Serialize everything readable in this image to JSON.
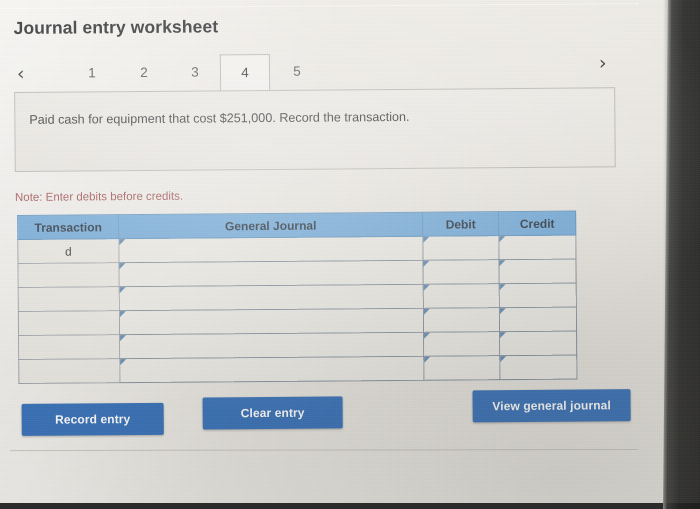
{
  "header": {
    "title": "Journal entry worksheet"
  },
  "pager": {
    "prev_icon": "chevron-left-icon",
    "next_icon": "chevron-right-icon",
    "prev_glyph": "‹",
    "next_glyph": "›",
    "tabs": [
      {
        "label": "1",
        "active": false
      },
      {
        "label": "2",
        "active": false
      },
      {
        "label": "3",
        "active": false
      },
      {
        "label": "4",
        "active": true
      },
      {
        "label": "5",
        "active": false
      }
    ],
    "active_tab": "4"
  },
  "question": {
    "text": "Paid cash for equipment that cost $251,000. Record the transaction."
  },
  "note": {
    "text": "Note: Enter debits before credits."
  },
  "table": {
    "columns": [
      "Transaction",
      "General Journal",
      "Debit",
      "Credit"
    ],
    "rows": [
      {
        "transaction": "d",
        "general_journal": "",
        "debit": "",
        "credit": ""
      },
      {
        "transaction": "",
        "general_journal": "",
        "debit": "",
        "credit": ""
      },
      {
        "transaction": "",
        "general_journal": "",
        "debit": "",
        "credit": ""
      },
      {
        "transaction": "",
        "general_journal": "",
        "debit": "",
        "credit": ""
      },
      {
        "transaction": "",
        "general_journal": "",
        "debit": "",
        "credit": ""
      },
      {
        "transaction": "",
        "general_journal": "",
        "debit": "",
        "credit": ""
      }
    ]
  },
  "buttons": {
    "record_entry": "Record entry",
    "clear_entry": "Clear entry",
    "view_general_journal": "View general journal"
  },
  "colors": {
    "table_header_blue": "#6ea7d8",
    "button_blue": "#2f6cb7",
    "note_red": "#9b4a48",
    "page_background": "#eceae5",
    "cell_border": "#7e8b98"
  }
}
